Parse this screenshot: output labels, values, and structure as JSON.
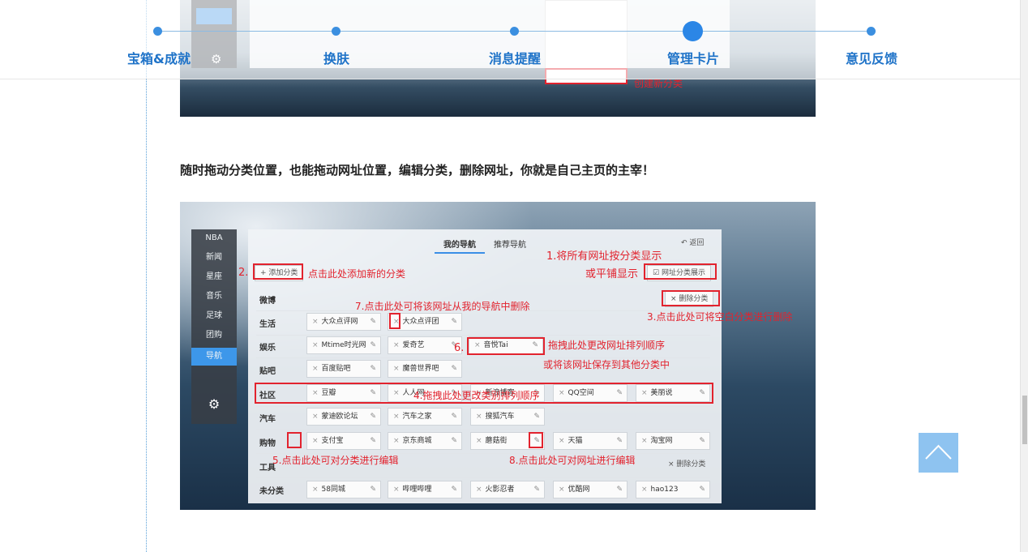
{
  "nav": {
    "items": [
      "宝箱&成就",
      "换肤",
      "消息提醒",
      "管理卡片",
      "意见反馈"
    ],
    "active_index": 3
  },
  "top_shot": {
    "create_category": "创建新分类"
  },
  "caption": "随时拖动分类位置，也能拖动网址位置，编辑分类，删除网址，你就是自己主页的主宰！",
  "screenshot": {
    "sidebar": [
      "NBA",
      "新闻",
      "星座",
      "音乐",
      "足球",
      "团购",
      "导航"
    ],
    "tabs": [
      "我的导航",
      "推荐导航"
    ],
    "back": "返回",
    "add_category": "+ 添加分类",
    "toggle_label": "网址分类展示",
    "delete_category": "删除分类",
    "rows": [
      {
        "label": "微博",
        "chips": []
      },
      {
        "label": "生活",
        "chips": [
          "大众点评网",
          "大众点评团"
        ]
      },
      {
        "label": "娱乐",
        "chips": [
          "Mtime时光网",
          "爱奇艺",
          "音悦Tai"
        ]
      },
      {
        "label": "贴吧",
        "chips": [
          "百度贴吧",
          "魔兽世界吧"
        ]
      },
      {
        "label": "社区",
        "chips": [
          "豆瓣",
          "人人网",
          "新浪博客",
          "QQ空间",
          "美丽说"
        ]
      },
      {
        "label": "汽车",
        "chips": [
          "蒙迪欧论坛",
          "汽车之家",
          "搜狐汽车"
        ]
      },
      {
        "label": "购物",
        "chips": [
          "支付宝",
          "京东商城",
          "蘑菇街",
          "天猫",
          "淘宝网"
        ]
      },
      {
        "label": "工具",
        "chips": []
      },
      {
        "label": "未分类",
        "chips": [
          "58同城",
          "哔哩哔哩",
          "火影忍者",
          "优酷网",
          "hao123"
        ]
      }
    ],
    "annotations": {
      "a1_line1": "1.将所有网址按分类显示",
      "a1_line2": "或平铺显示",
      "a2_num": "2.",
      "a2_text": "点击此处添加新的分类",
      "a3": "3.点击此处可将空白分类进行删除",
      "a4": "4.拖拽此处更改类别排列顺序",
      "a5": "5.点击此处可对分类进行编辑",
      "a6_num": "6.",
      "a6_line1": "拖拽此处更改网址排列顺序",
      "a6_line2": "或将该网址保存到其他分类中",
      "a7": "7.点击此处可将该网址从我的导航中删除",
      "a8": "8.点击此处可对网址进行编辑"
    }
  },
  "icons": {
    "gear": "gear-icon",
    "back_to_top": "chevron-up-icon",
    "edit": "pencil-icon",
    "close": "close-icon",
    "back_arrow": "back-arrow-icon"
  },
  "colors": {
    "accent": "#2b86e6",
    "annotation": "#e2232e",
    "back_to_top": "#8ec3f0"
  }
}
